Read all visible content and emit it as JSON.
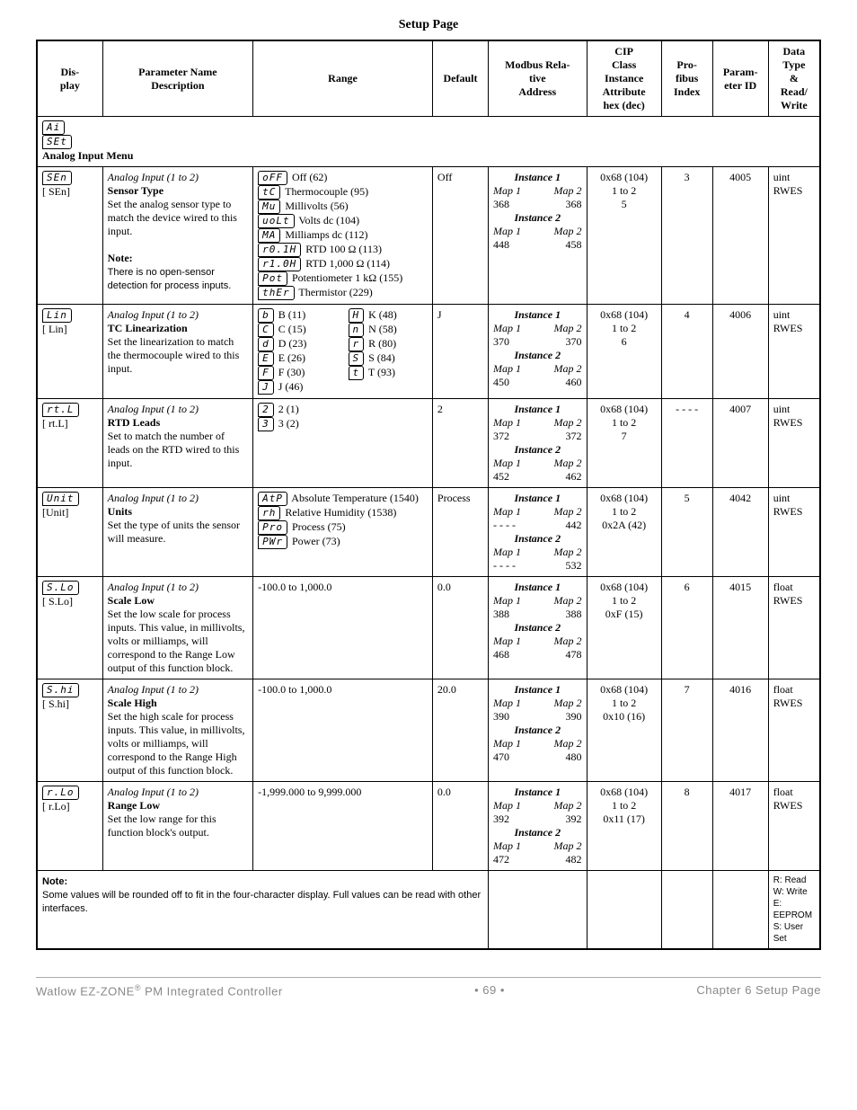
{
  "page_title": "Setup Page",
  "columns": {
    "c1": "Dis-\nplay",
    "c2": "Parameter Name\nDescription",
    "c3": "Range",
    "c4": "Default",
    "c5": "Modbus Rela-\ntive\nAddress",
    "c6": "CIP\nClass\nInstance\nAttribute\nhex (dec)",
    "c7": "Pro-\nfibus\nIndex",
    "c8": "Param-\neter ID",
    "c9": "Data\nType\n&\nRead/\nWrite"
  },
  "menu": {
    "seg1": "Ai",
    "seg2": "SEt",
    "title": "Analog Input Menu"
  },
  "rows": [
    {
      "seg": "SEn",
      "bracket": "[ SEn]",
      "group": "Analog Input (1 to 2)",
      "name": "Sensor Type",
      "desc": "Set the analog sensor type to match the device wired to this input.",
      "note": "Note:",
      "note_text": "There is no open-sensor detection for process inputs.",
      "range_type": "opts",
      "opts": [
        {
          "seg": "oFF",
          "label": "Off (62)"
        },
        {
          "seg": "tC",
          "label": "Thermocouple (95)"
        },
        {
          "seg": "Mu",
          "label": "Millivolts (56)"
        },
        {
          "seg": "uoLt",
          "label": "Volts dc (104)"
        },
        {
          "seg": "MA",
          "label": "Milliamps dc (112)"
        },
        {
          "seg": "r0.1H",
          "label": "RTD 100 Ω (113)"
        },
        {
          "seg": "r1.0H",
          "label": "RTD 1,000 Ω (114)"
        },
        {
          "seg": "Pot",
          "label": "Potentiometer 1 kΩ (155)"
        },
        {
          "seg": "thEr",
          "label": "Thermistor (229)"
        }
      ],
      "default": "Off",
      "modbus": {
        "i1": {
          "m1": "368",
          "m2": "368"
        },
        "i2": {
          "m1": "448",
          "m2": "458"
        }
      },
      "cip": [
        "0x68 (104)",
        "1 to 2",
        "5"
      ],
      "profibus": "3",
      "pid": "4005",
      "dtype": "uint\nRWES"
    },
    {
      "seg": "Lin",
      "bracket": "[ Lin]",
      "group": "Analog Input (1 to 2)",
      "name": "TC Linearization",
      "desc": "Set the linearization to match the thermocouple wired to this input.",
      "range_type": "opts2col",
      "opts_left": [
        {
          "seg": "b",
          "label": "B (11)"
        },
        {
          "seg": "C",
          "label": "C (15)"
        },
        {
          "seg": "d",
          "label": "D (23)"
        },
        {
          "seg": "E",
          "label": "E (26)"
        },
        {
          "seg": "F",
          "label": "F (30)"
        },
        {
          "seg": "J",
          "label": "J (46)"
        }
      ],
      "opts_right": [
        {
          "seg": "H",
          "label": "K (48)"
        },
        {
          "seg": "n",
          "label": "N (58)"
        },
        {
          "seg": "r",
          "label": "R (80)"
        },
        {
          "seg": "S",
          "label": "S (84)"
        },
        {
          "seg": "t",
          "label": "T (93)"
        }
      ],
      "default": "J",
      "modbus": {
        "i1": {
          "m1": "370",
          "m2": "370"
        },
        "i2": {
          "m1": "450",
          "m2": "460"
        }
      },
      "cip": [
        "0x68 (104)",
        "1 to 2",
        "6"
      ],
      "profibus": "4",
      "pid": "4006",
      "dtype": "uint\nRWES"
    },
    {
      "seg": "rt.L",
      "bracket": "[ rt.L]",
      "group": "Analog Input (1 to 2)",
      "name": "RTD Leads",
      "desc": "Set to match the number of leads on the RTD wired to this input.",
      "range_type": "opts",
      "opts": [
        {
          "seg": "2",
          "label": "2 (1)"
        },
        {
          "seg": "3",
          "label": "3 (2)"
        }
      ],
      "default": "2",
      "modbus": {
        "i1": {
          "m1": "372",
          "m2": "372"
        },
        "i2": {
          "m1": "452",
          "m2": "462"
        }
      },
      "cip": [
        "0x68 (104)",
        "1 to 2",
        "7"
      ],
      "profibus": "- - - -",
      "pid": "4007",
      "dtype": "uint\nRWES"
    },
    {
      "seg": "Unit",
      "bracket": "[Unit]",
      "group": "Analog Input (1 to 2)",
      "name": "Units",
      "desc": "Set the type of units the sensor will measure.",
      "range_type": "opts",
      "opts": [
        {
          "seg": "AtP",
          "label": "Absolute Temperature (1540)"
        },
        {
          "seg": "rh",
          "label": "Relative Humidity (1538)"
        },
        {
          "seg": "Pro",
          "label": "Process (75)"
        },
        {
          "seg": "PWr",
          "label": "Power (73)"
        }
      ],
      "default": "Process",
      "modbus": {
        "i1": {
          "m1": "- - - -",
          "m2": "442"
        },
        "i2": {
          "m1": "- - - -",
          "m2": "532"
        }
      },
      "cip": [
        "0x68 (104)",
        "1 to 2",
        "0x2A (42)"
      ],
      "profibus": "5",
      "pid": "4042",
      "dtype": "uint\nRWES"
    },
    {
      "seg": "S.Lo",
      "bracket": "[ S.Lo]",
      "group": "Analog Input (1 to 2)",
      "name": "Scale Low",
      "desc": "Set the low scale for process inputs. This value, in millivolts, volts or milliamps, will correspond to the Range Low output of this function block.",
      "range_type": "text",
      "range_text": "-100.0 to 1,000.0",
      "default": "0.0",
      "modbus": {
        "i1": {
          "m1": "388",
          "m2": "388"
        },
        "i2": {
          "m1": "468",
          "m2": "478"
        }
      },
      "cip": [
        "0x68 (104)",
        "1 to 2",
        "0xF (15)"
      ],
      "profibus": "6",
      "pid": "4015",
      "dtype": "float\nRWES"
    },
    {
      "seg": "S.hi",
      "bracket": "[ S.hi]",
      "group": "Analog Input (1 to 2)",
      "name": "Scale High",
      "desc": "Set the high scale for process inputs. This value, in millivolts, volts or milliamps, will correspond to the Range High output of this function block.",
      "range_type": "text",
      "range_text": "-100.0 to 1,000.0",
      "default": "20.0",
      "modbus": {
        "i1": {
          "m1": "390",
          "m2": "390"
        },
        "i2": {
          "m1": "470",
          "m2": "480"
        }
      },
      "cip": [
        "0x68 (104)",
        "1 to 2",
        "0x10 (16)"
      ],
      "profibus": "7",
      "pid": "4016",
      "dtype": "float\nRWES"
    },
    {
      "seg": "r.Lo",
      "bracket": "[ r.Lo]",
      "group": "Analog Input (1 to 2)",
      "name": "Range Low",
      "desc": "Set the low range for this function block's output.",
      "range_type": "text",
      "range_text": "-1,999.000 to 9,999.000",
      "default": "0.0",
      "modbus": {
        "i1": {
          "m1": "392",
          "m2": "392"
        },
        "i2": {
          "m1": "472",
          "m2": "482"
        }
      },
      "cip": [
        "0x68 (104)",
        "1 to 2",
        "0x11 (17)"
      ],
      "profibus": "8",
      "pid": "4017",
      "dtype": "float\nRWES"
    }
  ],
  "bottom_note": {
    "label": "Note:",
    "text": "Some values will be rounded off to fit in the four-character display. Full values can be read with other interfaces."
  },
  "rw_legend": [
    "R: Read",
    "W: Write",
    "E: EEPROM",
    "S: User Set"
  ],
  "footer": {
    "left_a": "Watlow EZ-ZONE",
    "left_b": " PM Integrated Controller",
    "center": "•  69  •",
    "right": "Chapter 6 Setup Page"
  }
}
